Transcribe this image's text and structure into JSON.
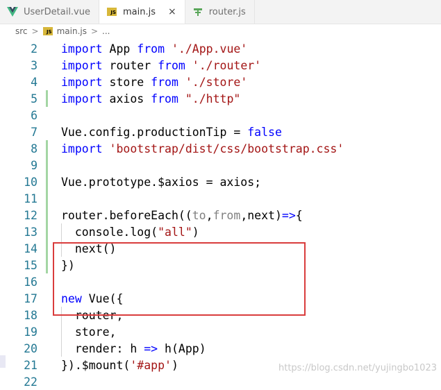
{
  "tabs": [
    {
      "label": "UserDetail.vue",
      "icon": "vue-icon",
      "active": false
    },
    {
      "label": "main.js",
      "icon": "js-icon",
      "active": true,
      "close": "×"
    },
    {
      "label": "router.js",
      "icon": "router-file-icon",
      "active": false
    }
  ],
  "breadcrumb": {
    "folder": "src",
    "sep1": ">",
    "file": "main.js",
    "sep2": ">",
    "more": "..."
  },
  "js_badge": "JS",
  "lines": [
    {
      "n": "2"
    },
    {
      "n": "3"
    },
    {
      "n": "4"
    },
    {
      "n": "5"
    },
    {
      "n": "6"
    },
    {
      "n": "7"
    },
    {
      "n": "8"
    },
    {
      "n": "9"
    },
    {
      "n": "10"
    },
    {
      "n": "11"
    },
    {
      "n": "12"
    },
    {
      "n": "13"
    },
    {
      "n": "14"
    },
    {
      "n": "15"
    },
    {
      "n": "16"
    },
    {
      "n": "17"
    },
    {
      "n": "18"
    },
    {
      "n": "19"
    },
    {
      "n": "20"
    },
    {
      "n": "21"
    },
    {
      "n": "22"
    }
  ],
  "code": {
    "import": "import",
    "from": "from",
    "l2_id": " App ",
    "l2_str": "'./App.vue'",
    "l3_id": " router ",
    "l3_str": "'./router'",
    "l4_id": " store ",
    "l4_str": "'./store'",
    "l5_id": " axios ",
    "l5_str": "\"./http\"",
    "l7_a": "Vue.config.productionTip = ",
    "l7_false": "false",
    "l8_str": "'bootstrap/dist/css/bootstrap.css'",
    "l10": "Vue.prototype.$axios = axios;",
    "l12_a": "router.beforeEach((",
    "l12_to": "to",
    "l12_comma": ",",
    "l12_from": "from",
    "l12_b": ",next)",
    "l12_arrow": "=>",
    "l12_c": "{",
    "l13_a": "  console.log(",
    "l13_str": "\"all\"",
    "l13_b": ")",
    "l14": "  next()",
    "l15": "})",
    "l17_new": "new",
    "l17_b": " Vue({",
    "l18": "  router,",
    "l19": "  store,",
    "l20_a": "  render: h ",
    "l20_arrow": "=>",
    "l20_b": " h(App)",
    "l21_a": "}).$mount(",
    "l21_str": "'#app'",
    "l21_b": ")"
  },
  "watermark": "https://blog.csdn.net/yujingbo1023",
  "colors": {
    "keyword": "#0000ff",
    "string": "#a31515",
    "line_number": "#237893",
    "highlight": "#d93c3c",
    "git_added": "#a4d6a4"
  }
}
